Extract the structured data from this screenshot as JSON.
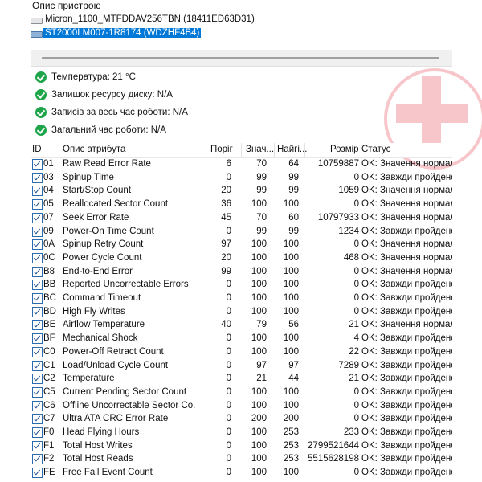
{
  "devices_label": "Опис пристрою",
  "devices": [
    {
      "name": "Micron_1100_MTFDDAV256TBN (18411ED63D31)",
      "type": "ssd",
      "selected": false
    },
    {
      "name": "ST2000LM007-1R8174 (WDZHF4B4)",
      "type": "hdd",
      "selected": true
    }
  ],
  "health": [
    "Температура: 21 °C",
    "Залишок ресурсу диску: N/A",
    "Записів за весь час роботи: N/A",
    "Загальний час роботи: N/A"
  ],
  "columns": {
    "id": "ID",
    "name": "Опис атрибута",
    "threshold": "Поріг",
    "value": "Знач...",
    "worst": "Найгі...",
    "raw": "Розмір",
    "status": "Статус"
  },
  "attributes": [
    {
      "id": "01",
      "name": "Raw Read Error Rate",
      "threshold": "6",
      "value": "70",
      "worst": "64",
      "raw": "10759887",
      "status": "OK: Значення нормальне"
    },
    {
      "id": "03",
      "name": "Spinup Time",
      "threshold": "0",
      "value": "99",
      "worst": "99",
      "raw": "0",
      "status": "OK: Завжди пройдено"
    },
    {
      "id": "04",
      "name": "Start/Stop Count",
      "threshold": "20",
      "value": "99",
      "worst": "99",
      "raw": "1059",
      "status": "OK: Значення нормальне"
    },
    {
      "id": "05",
      "name": "Reallocated Sector Count",
      "threshold": "36",
      "value": "100",
      "worst": "100",
      "raw": "0",
      "status": "OK: Значення нормальне"
    },
    {
      "id": "07",
      "name": "Seek Error Rate",
      "threshold": "45",
      "value": "70",
      "worst": "60",
      "raw": "10797933",
      "status": "OK: Значення нормальне"
    },
    {
      "id": "09",
      "name": "Power-On Time Count",
      "threshold": "0",
      "value": "99",
      "worst": "99",
      "raw": "1234",
      "status": "OK: Завжди пройдено"
    },
    {
      "id": "0A",
      "name": "Spinup Retry Count",
      "threshold": "97",
      "value": "100",
      "worst": "100",
      "raw": "0",
      "status": "OK: Значення нормальне"
    },
    {
      "id": "0C",
      "name": "Power Cycle Count",
      "threshold": "20",
      "value": "100",
      "worst": "100",
      "raw": "468",
      "status": "OK: Значення нормальне"
    },
    {
      "id": "B8",
      "name": "End-to-End Error",
      "threshold": "99",
      "value": "100",
      "worst": "100",
      "raw": "0",
      "status": "OK: Значення нормальне"
    },
    {
      "id": "BB",
      "name": "Reported Uncorrectable Errors",
      "threshold": "0",
      "value": "100",
      "worst": "100",
      "raw": "0",
      "status": "OK: Завжди пройдено"
    },
    {
      "id": "BC",
      "name": "Command Timeout",
      "threshold": "0",
      "value": "100",
      "worst": "100",
      "raw": "0",
      "status": "OK: Завжди пройдено"
    },
    {
      "id": "BD",
      "name": "High Fly Writes",
      "threshold": "0",
      "value": "100",
      "worst": "100",
      "raw": "0",
      "status": "OK: Завжди пройдено"
    },
    {
      "id": "BE",
      "name": "Airflow Temperature",
      "threshold": "40",
      "value": "79",
      "worst": "56",
      "raw": "21",
      "status": "OK: Значення нормальне"
    },
    {
      "id": "BF",
      "name": "Mechanical Shock",
      "threshold": "0",
      "value": "100",
      "worst": "100",
      "raw": "4",
      "status": "OK: Завжди пройдено"
    },
    {
      "id": "C0",
      "name": "Power-Off Retract Count",
      "threshold": "0",
      "value": "100",
      "worst": "100",
      "raw": "22",
      "status": "OK: Завжди пройдено"
    },
    {
      "id": "C1",
      "name": "Load/Unload Cycle Count",
      "threshold": "0",
      "value": "97",
      "worst": "97",
      "raw": "7289",
      "status": "OK: Завжди пройдено"
    },
    {
      "id": "C2",
      "name": "Temperature",
      "threshold": "0",
      "value": "21",
      "worst": "44",
      "raw": "21",
      "status": "OK: Завжди пройдено"
    },
    {
      "id": "C5",
      "name": "Current Pending Sector Count",
      "threshold": "0",
      "value": "100",
      "worst": "100",
      "raw": "0",
      "status": "OK: Завжди пройдено"
    },
    {
      "id": "C6",
      "name": "Offline Uncorrectable Sector Co...",
      "threshold": "0",
      "value": "100",
      "worst": "100",
      "raw": "0",
      "status": "OK: Завжди пройдено"
    },
    {
      "id": "C7",
      "name": "Ultra ATA CRC Error Rate",
      "threshold": "0",
      "value": "200",
      "worst": "200",
      "raw": "0",
      "status": "OK: Завжди пройдено"
    },
    {
      "id": "F0",
      "name": "Head Flying Hours",
      "threshold": "0",
      "value": "100",
      "worst": "253",
      "raw": "233",
      "status": "OK: Завжди пройдено"
    },
    {
      "id": "F1",
      "name": "Total Host Writes",
      "threshold": "0",
      "value": "100",
      "worst": "253",
      "raw": "2799521644",
      "status": "OK: Завжди пройдено"
    },
    {
      "id": "F2",
      "name": "Total Host Reads",
      "threshold": "0",
      "value": "100",
      "worst": "253",
      "raw": "5515628198",
      "status": "OK: Завжди пройдено"
    },
    {
      "id": "FE",
      "name": "Free Fall Event Count",
      "threshold": "0",
      "value": "100",
      "worst": "100",
      "raw": "0",
      "status": "OK: Завжди пройдено"
    }
  ]
}
